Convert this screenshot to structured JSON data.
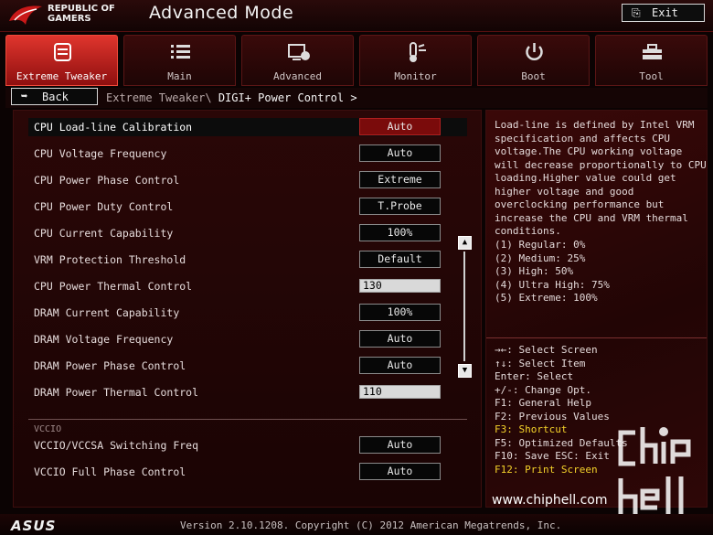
{
  "header": {
    "brand_line1": "REPUBLIC OF",
    "brand_line2": "GAMERS",
    "title": "Advanced Mode",
    "exit_label": "Exit"
  },
  "tabs": [
    {
      "label": "Extreme Tweaker",
      "icon": "tweaker-icon",
      "active": true
    },
    {
      "label": "Main",
      "icon": "list-icon",
      "active": false
    },
    {
      "label": "Advanced",
      "icon": "advanced-icon",
      "active": false
    },
    {
      "label": "Monitor",
      "icon": "monitor-icon",
      "active": false
    },
    {
      "label": "Boot",
      "icon": "power-icon",
      "active": false
    },
    {
      "label": "Tool",
      "icon": "toolbox-icon",
      "active": false
    }
  ],
  "breadcrumb": {
    "back_label": "Back",
    "path": "Extreme Tweaker\\",
    "current": "DIGI+ Power Control >"
  },
  "settings": [
    {
      "label": "CPU Load-line Calibration",
      "value": "Auto"
    },
    {
      "label": "CPU Voltage Frequency",
      "value": "Auto"
    },
    {
      "label": "CPU Power Phase Control",
      "value": "Extreme"
    },
    {
      "label": "CPU Power Duty Control",
      "value": "T.Probe"
    },
    {
      "label": "CPU Current Capability",
      "value": "100%"
    },
    {
      "label": "VRM Protection Threshold",
      "value": "Default"
    },
    {
      "label": "CPU Power Thermal Control",
      "value": "130"
    },
    {
      "label": "DRAM Current Capability",
      "value": "100%"
    },
    {
      "label": "DRAM Voltage Frequency",
      "value": "Auto"
    },
    {
      "label": "DRAM Power Phase Control",
      "value": "Auto"
    },
    {
      "label": "DRAM Power Thermal Control",
      "value": "110"
    }
  ],
  "vccio": {
    "section_label": "VCCIO",
    "items": [
      {
        "label": "VCCIO/VCCSA Switching Freq",
        "value": "Auto"
      },
      {
        "label": "VCCIO Full Phase Control",
        "value": "Auto"
      }
    ]
  },
  "help": {
    "description": "Load-line is defined by Intel VRM specification and affects CPU voltage.The CPU working voltage will decrease proportionally to CPU loading.Higher value could get higher voltage and good overclocking performance but increase the CPU and VRM thermal conditions.",
    "options": [
      "(1) Regular: 0%",
      "(2) Medium: 25%",
      "(3) High: 50%",
      "(4) Ultra High: 75%",
      "(5) Extreme: 100%"
    ]
  },
  "keys": [
    {
      "text": "→←: Select Screen",
      "highlight": false
    },
    {
      "text": "↑↓: Select Item",
      "highlight": false
    },
    {
      "text": "Enter: Select",
      "highlight": false
    },
    {
      "text": "+/-: Change Opt.",
      "highlight": false
    },
    {
      "text": "F1: General Help",
      "highlight": false
    },
    {
      "text": "F2: Previous Values",
      "highlight": false
    },
    {
      "text": "F3: Shortcut",
      "highlight": true
    },
    {
      "text": "F5: Optimized Defaults",
      "highlight": false
    },
    {
      "text": "F10: Save  ESC: Exit",
      "highlight": false
    },
    {
      "text": "F12: Print Screen",
      "highlight": true
    }
  ],
  "watermark": {
    "url": "www.chiphell.com",
    "logo_text": "chip hell"
  },
  "footer": {
    "brand": "ASUS",
    "version": "Version 2.10.1208. Copyright (C) 2012 American Megatrends, Inc."
  },
  "colors": {
    "accent_red": "#e0352d",
    "selected_value_bg": "#7a0b0b",
    "key_highlight": "#f5d32a"
  }
}
